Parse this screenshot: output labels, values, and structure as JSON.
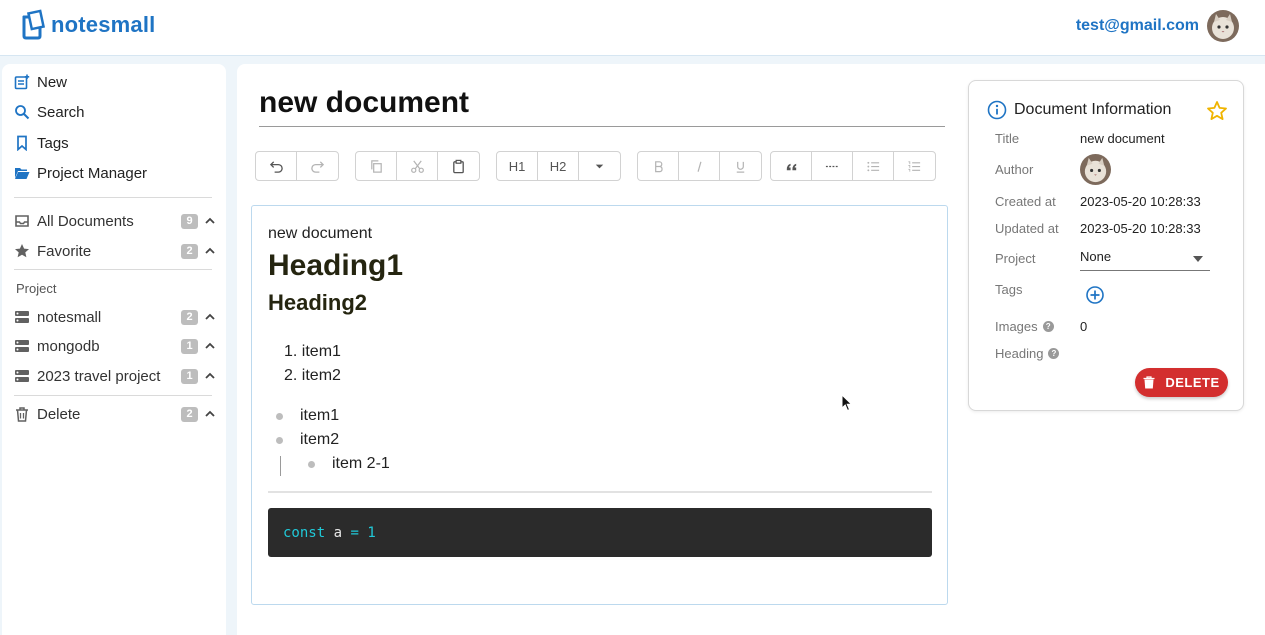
{
  "app": {
    "name": "notesmall",
    "brand_color": "#1f74c4"
  },
  "user": {
    "email": "test@gmail.com"
  },
  "sidebar": {
    "nav": [
      {
        "label": "New",
        "icon": "new-note-icon"
      },
      {
        "label": "Search",
        "icon": "search-icon"
      },
      {
        "label": "Tags",
        "icon": "bookmark-icon"
      },
      {
        "label": "Project Manager",
        "icon": "folder-open-icon"
      }
    ],
    "documents": [
      {
        "label": "All Documents",
        "count": "9",
        "icon": "inbox-icon"
      },
      {
        "label": "Favorite",
        "count": "2",
        "icon": "star-icon"
      }
    ],
    "project_heading": "Project",
    "projects": [
      {
        "label": "notesmall",
        "count": "2"
      },
      {
        "label": "mongodb",
        "count": "1"
      },
      {
        "label": "2023 travel project",
        "count": "1"
      }
    ],
    "delete": {
      "label": "Delete",
      "count": "2"
    }
  },
  "document": {
    "title": "new document",
    "toolbar": {
      "heading1": "H1",
      "heading2": "H2"
    },
    "content": {
      "paragraph": "new document",
      "heading1": "Heading1",
      "heading2": "Heading2",
      "ordered_list": [
        "1. item1",
        "2. item2"
      ],
      "bullet_list": [
        "item1",
        "item2"
      ],
      "nested_bullet": "item 2-1",
      "code": {
        "keyword": "const",
        "variable": "a",
        "operator": "=",
        "value": "1"
      }
    }
  },
  "info": {
    "heading": "Document Information",
    "labels": {
      "title": "Title",
      "author": "Author",
      "created": "Created at",
      "updated": "Updated at",
      "project": "Project",
      "tags": "Tags",
      "images": "Images",
      "heading": "Heading"
    },
    "values": {
      "title": "new document",
      "created": "2023-05-20 10:28:33",
      "updated": "2023-05-20 10:28:33",
      "project": "None",
      "images": "0"
    },
    "delete_label": "DELETE",
    "delete_color": "#d32f2f",
    "star_color": "#f0b400"
  }
}
